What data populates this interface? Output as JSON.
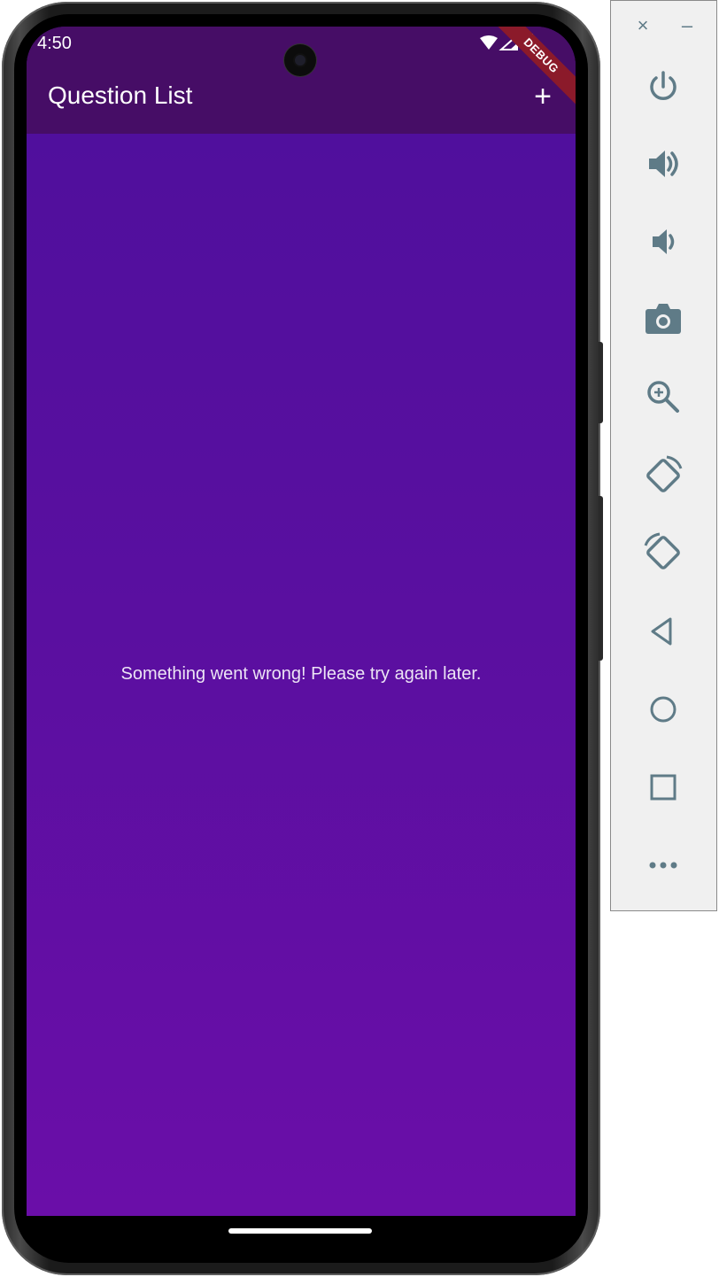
{
  "status_bar": {
    "time": "4:50",
    "debug_label": "DEBUG"
  },
  "app_bar": {
    "title": "Question List",
    "add_icon": "plus-icon",
    "add_glyph": "+"
  },
  "body": {
    "message": "Something went wrong! Please try again later."
  },
  "colors": {
    "app_bar": "#460d66",
    "background_top": "#4e0f9c",
    "background_bottom": "#6a0ea8",
    "debug_ribbon": "#8b1a2a",
    "emulator_icon": "#5f7b87"
  },
  "emulator_toolbar": {
    "close_glyph": "×",
    "minimize_glyph": "–",
    "buttons": [
      "power-icon",
      "volume-up-icon",
      "volume-down-icon",
      "camera-icon",
      "zoom-icon",
      "rotate-left-icon",
      "rotate-right-icon",
      "back-icon",
      "home-icon",
      "overview-icon",
      "more-icon"
    ]
  }
}
